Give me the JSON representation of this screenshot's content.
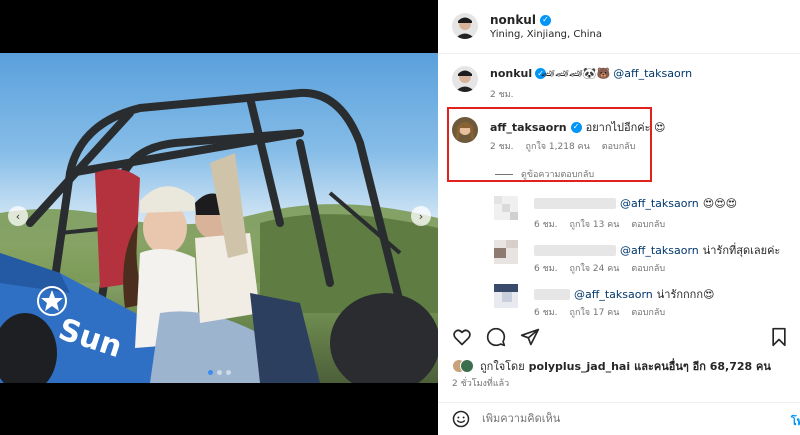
{
  "post": {
    "author": "nonkul",
    "location": "Yining, Xinjiang, China"
  },
  "caption": {
    "user": "nonkul",
    "emojis": "🏎🏎🏎🐼🐻",
    "mention": "@aff_taksaorn",
    "time": "2 ชม."
  },
  "highlighted_comment": {
    "user": "aff_taksaorn",
    "text": "อยากไปอีกค่ะ 😍",
    "time": "2 ชม.",
    "likes": "ถูกใจ 1,218 คน",
    "reply": "ตอบกลับ",
    "view_replies": "ดูข้อความตอบกลับ"
  },
  "comments": [
    {
      "mention": "@aff_taksaorn",
      "text": "😍😍😍",
      "time": "6 ชม.",
      "likes": "ถูกใจ 13 คน",
      "reply": "ตอบกลับ"
    },
    {
      "mention": "@aff_taksaorn",
      "text": "น่ารักที่สุดเลยค่ะ",
      "time": "6 ชม.",
      "likes": "ถูกใจ 24 คน",
      "reply": "ตอบกลับ"
    },
    {
      "mention": "@aff_taksaorn",
      "text": "น่ารักกกก😍",
      "time": "6 ชม.",
      "likes": "ถูกใจ 17 คน",
      "reply": "ตอบกลับ"
    }
  ],
  "likes_summary": {
    "prefix": "ถูกใจโดย",
    "user": "polyplus_jad_hai",
    "suffix": "และคนอื่นๆ อีก 68,728 คน"
  },
  "posted_ago": "2 ชั่วโมงที่แล้ว",
  "add_comment": {
    "placeholder": "เพิ่มความคิดเห็น",
    "post_label": "โพ"
  },
  "photo_text": "Sun",
  "carousel": {
    "dots": 3,
    "active_index": 0
  },
  "colors": {
    "accent": "#0095f6",
    "highlight": "#e0211c",
    "jeep": "#2f6fc4"
  }
}
